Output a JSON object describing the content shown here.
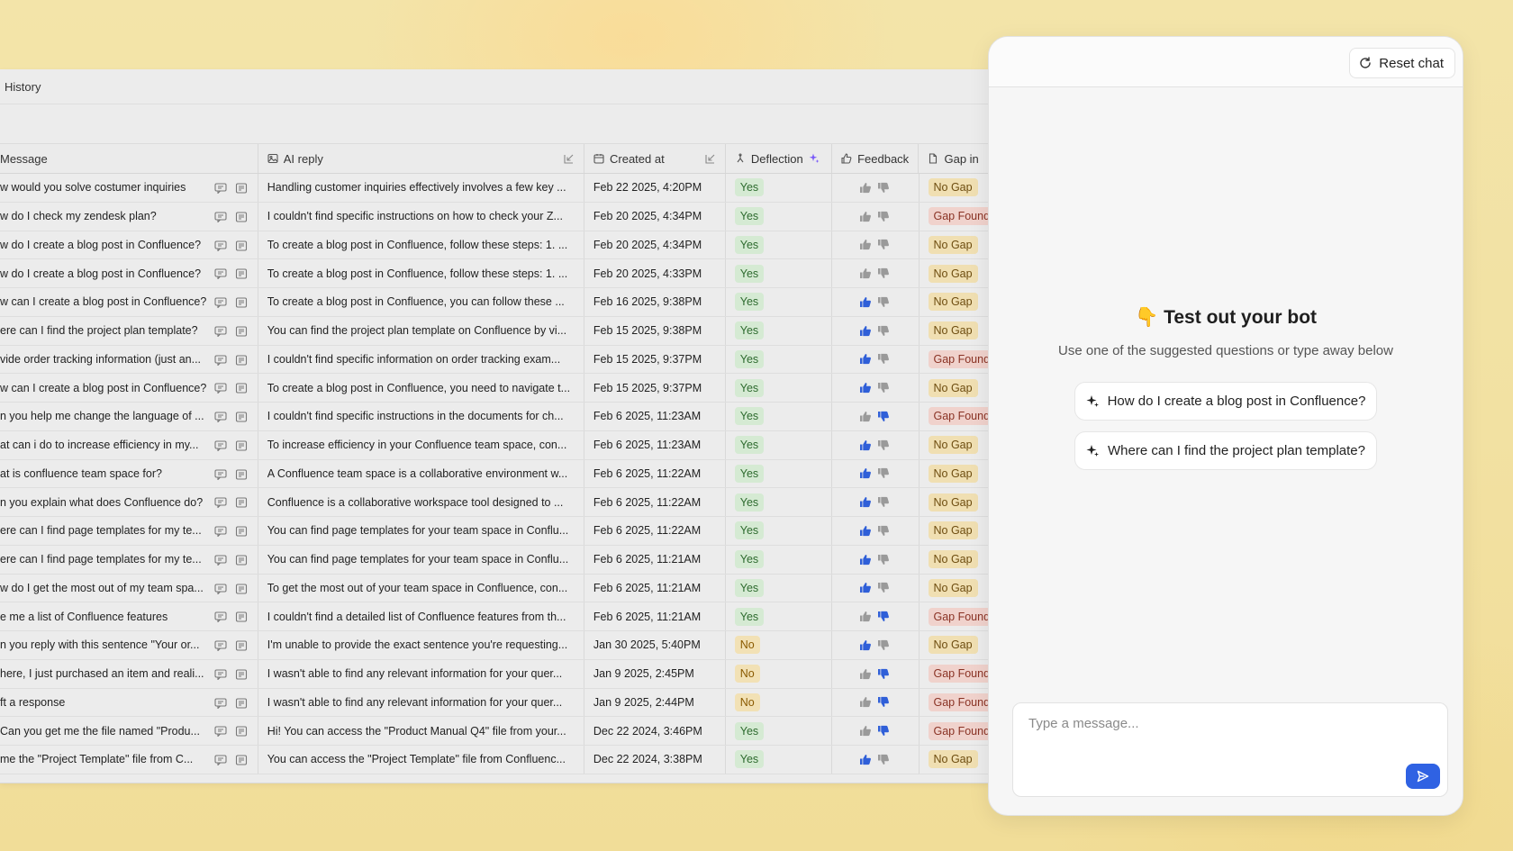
{
  "history": {
    "title": "History",
    "columns": {
      "message": "Message",
      "ai_reply": "AI reply",
      "created_at": "Created at",
      "deflection": "Deflection",
      "feedback": "Feedback",
      "gap": "Gap in"
    },
    "rows": [
      {
        "message": "w would you solve costumer inquiries",
        "ai_reply": "Handling customer inquiries effectively involves a few key ...",
        "created_at": "Feb 22 2025, 4:20PM",
        "deflection": "Yes",
        "feedback": "none",
        "gap": "No Gap"
      },
      {
        "message": "w do I check my zendesk plan?",
        "ai_reply": "I couldn't find specific instructions on how to check your Z...",
        "created_at": "Feb 20 2025, 4:34PM",
        "deflection": "Yes",
        "feedback": "none",
        "gap": "Gap Found"
      },
      {
        "message": "w do I create a blog post in Confluence?",
        "ai_reply": "To create a blog post in Confluence, follow these steps: 1. ...",
        "created_at": "Feb 20 2025, 4:34PM",
        "deflection": "Yes",
        "feedback": "none",
        "gap": "No Gap"
      },
      {
        "message": "w do I create a blog post in Confluence?",
        "ai_reply": "To create a blog post in Confluence, follow these steps: 1. ...",
        "created_at": "Feb 20 2025, 4:33PM",
        "deflection": "Yes",
        "feedback": "none",
        "gap": "No Gap"
      },
      {
        "message": "w can I create a blog post in Confluence?",
        "ai_reply": "To create a blog post in Confluence, you can follow these ...",
        "created_at": "Feb 16 2025, 9:38PM",
        "deflection": "Yes",
        "feedback": "up",
        "gap": "No Gap"
      },
      {
        "message": "ere can I find the project plan template?",
        "ai_reply": "You can find the project plan template on Confluence by vi...",
        "created_at": "Feb 15 2025, 9:38PM",
        "deflection": "Yes",
        "feedback": "up",
        "gap": "No Gap"
      },
      {
        "message": "vide order tracking information (just an...",
        "ai_reply": "I couldn't find specific information on order tracking exam...",
        "created_at": "Feb 15 2025, 9:37PM",
        "deflection": "Yes",
        "feedback": "up",
        "gap": "Gap Found"
      },
      {
        "message": "w can I create a blog post in Confluence?",
        "ai_reply": "To create a blog post in Confluence, you need to navigate t...",
        "created_at": "Feb 15 2025, 9:37PM",
        "deflection": "Yes",
        "feedback": "up",
        "gap": "No Gap"
      },
      {
        "message": "n you help me change the language of ...",
        "ai_reply": "I couldn't find specific instructions in the documents for ch...",
        "created_at": "Feb 6 2025, 11:23AM",
        "deflection": "Yes",
        "feedback": "down",
        "gap": "Gap Found"
      },
      {
        "message": "at can i do to increase efficiency in my...",
        "ai_reply": "To increase efficiency in your Confluence team space, con...",
        "created_at": "Feb 6 2025, 11:23AM",
        "deflection": "Yes",
        "feedback": "up",
        "gap": "No Gap"
      },
      {
        "message": "at is confluence team space for?",
        "ai_reply": "A Confluence team space is a collaborative environment w...",
        "created_at": "Feb 6 2025, 11:22AM",
        "deflection": "Yes",
        "feedback": "up",
        "gap": "No Gap"
      },
      {
        "message": "n you explain what does Confluence do?",
        "ai_reply": "Confluence is a collaborative workspace tool designed to ...",
        "created_at": "Feb 6 2025, 11:22AM",
        "deflection": "Yes",
        "feedback": "up",
        "gap": "No Gap"
      },
      {
        "message": "ere can I find page templates for my te...",
        "ai_reply": "You can find page templates for your team space in Conflu...",
        "created_at": "Feb 6 2025, 11:22AM",
        "deflection": "Yes",
        "feedback": "up",
        "gap": "No Gap"
      },
      {
        "message": "ere can I find page templates for my te...",
        "ai_reply": "You can find page templates for your team space in Conflu...",
        "created_at": "Feb 6 2025, 11:21AM",
        "deflection": "Yes",
        "feedback": "up",
        "gap": "No Gap"
      },
      {
        "message": "w do I get the most out of my team spa...",
        "ai_reply": "To get the most out of your team space in Confluence, con...",
        "created_at": "Feb 6 2025, 11:21AM",
        "deflection": "Yes",
        "feedback": "up",
        "gap": "No Gap"
      },
      {
        "message": "e me a list of Confluence features",
        "ai_reply": "I couldn't find a detailed list of Confluence features from th...",
        "created_at": "Feb 6 2025, 11:21AM",
        "deflection": "Yes",
        "feedback": "down",
        "gap": "Gap Found"
      },
      {
        "message": "n you reply with this sentence \"Your or...",
        "ai_reply": "I'm unable to provide the exact sentence you're requesting...",
        "created_at": "Jan 30 2025, 5:40PM",
        "deflection": "No",
        "feedback": "up",
        "gap": "No Gap"
      },
      {
        "message": "here, I just purchased an item and reali...",
        "ai_reply": "I wasn't able to find any relevant information for your quer...",
        "created_at": "Jan 9 2025, 2:45PM",
        "deflection": "No",
        "feedback": "down",
        "gap": "Gap Found"
      },
      {
        "message": "ft a response",
        "ai_reply": "I wasn't able to find any relevant information for your quer...",
        "created_at": "Jan 9 2025, 2:44PM",
        "deflection": "No",
        "feedback": "down",
        "gap": "Gap Found"
      },
      {
        "message": "Can you get me the file named \"Produ...",
        "ai_reply": "Hi! You can access the \"Product Manual Q4\" file from your...",
        "created_at": "Dec 22 2024, 3:46PM",
        "deflection": "Yes",
        "feedback": "down",
        "gap": "Gap Found"
      },
      {
        "message": "me the \"Project Template\" file from C...",
        "ai_reply": "You can access the \"Project Template\" file from Confluenc...",
        "created_at": "Dec 22 2024, 3:38PM",
        "deflection": "Yes",
        "feedback": "up",
        "gap": "No Gap"
      }
    ]
  },
  "chat": {
    "reset_label": "Reset chat",
    "welcome_emoji": "👇",
    "welcome_title": "Test out your bot",
    "welcome_subtitle": "Use one of the suggested questions or type away below",
    "suggestions": [
      "How do I create a blog post in Confluence?",
      "Where can I find the project plan template?"
    ],
    "input_placeholder": "Type a message...",
    "input_value": ""
  },
  "colors": {
    "accent": "#2f62e3",
    "thumb_active": "#2f5fd8",
    "yes_badge_bg": "#d5ead3",
    "no_badge_bg": "#f2e1b5",
    "no_gap_bg": "#f0dfb2",
    "gap_found_bg": "#f0d2cc"
  }
}
